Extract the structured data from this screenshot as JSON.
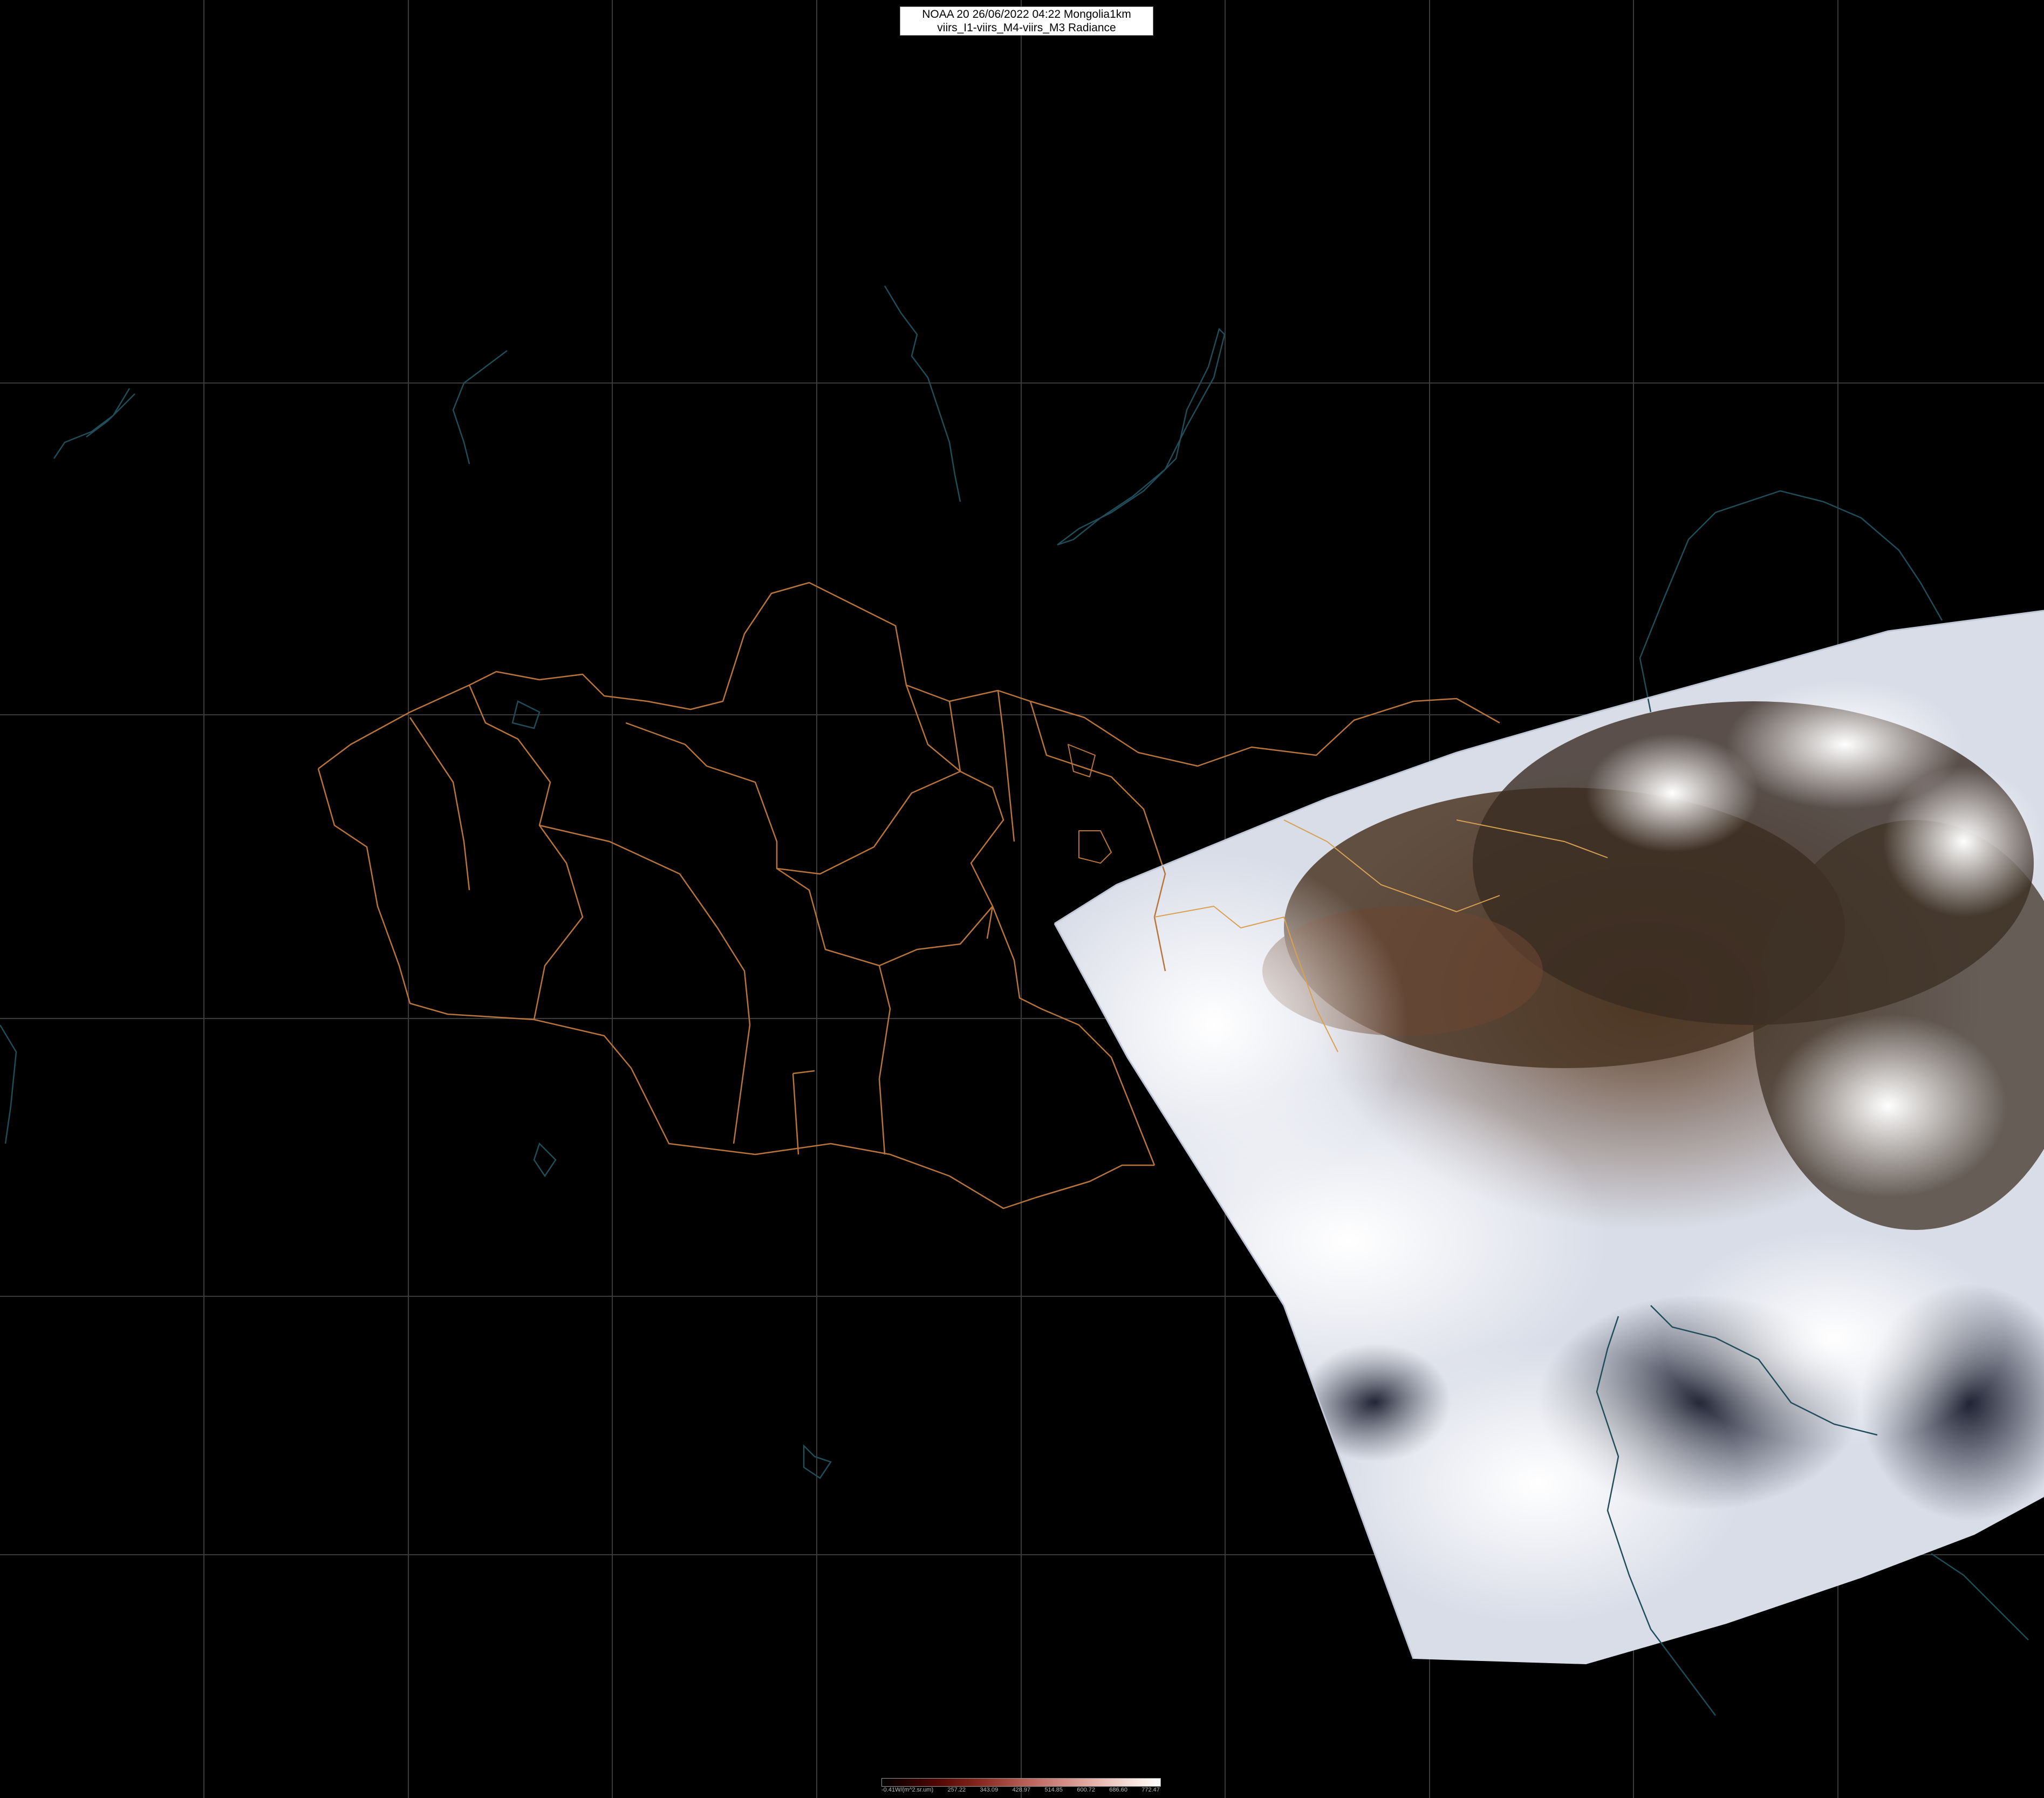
{
  "header": {
    "title_line1": "NOAA 20 26/06/2022 04:22 Mongolia1km",
    "title_line2": "viirs_I1-viirs_M4-viirs_M3 Radiance"
  },
  "legend": {
    "unit_label": "-0.41W/(m^2.sr.um)",
    "ticks": [
      "257.22",
      "343.09",
      "428.97",
      "514.85",
      "600.72",
      "686.60",
      "772.47"
    ]
  },
  "colors": {
    "background": "#000000",
    "graticule": "#3a3a3a",
    "admin_border": "#b8743a",
    "coastline": "#1f4d5a",
    "cloud": "#e8ecf4",
    "land": "#4a3422",
    "sea": "#232838"
  }
}
